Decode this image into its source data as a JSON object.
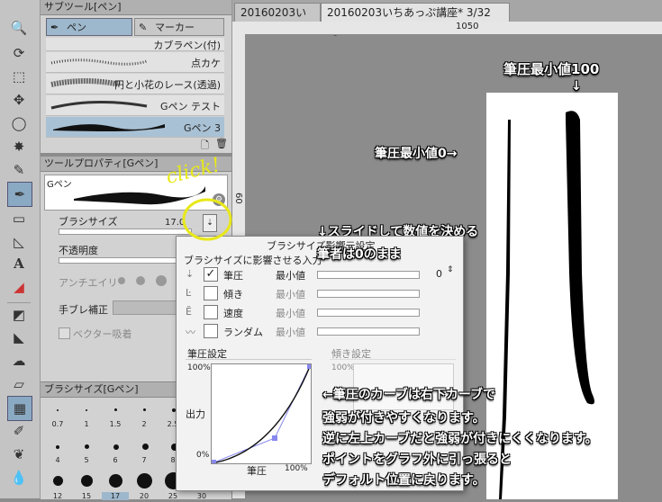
{
  "toolbar": {
    "tools": [
      "magnifier-icon",
      "rotate-icon",
      "object-icon",
      "move-icon",
      "lasso-icon",
      "wand-icon",
      "eyedropper-icon",
      "pen-icon",
      "brush-icon",
      "eraser-icon",
      "ruler-icon",
      "text-icon",
      "fill-icon"
    ]
  },
  "subtool": {
    "title": "サブツール[ペン]",
    "tab_pen": "ペン",
    "tab_marker": "マーカー",
    "brushes": [
      {
        "label": "カブラペン(付)"
      },
      {
        "label": "点カケ"
      },
      {
        "label": "円と小花のレース(透過)"
      },
      {
        "label": "Gペン テスト"
      },
      {
        "label": "Gペン 3"
      }
    ]
  },
  "toolprop": {
    "title": "ツールプロパティ[Gペン]",
    "preview_label": "Gペン",
    "brush_size_label": "ブラシサイズ",
    "brush_size_value": "17.0",
    "opacity_label": "不透明度",
    "antialias_label": "アンチエイリ",
    "stabilize_label": "手ブレ補正",
    "vector_label": "ベクター吸着"
  },
  "brushsize": {
    "title": "ブラシサイズ[Gペン]",
    "row1": [
      "0.7",
      "1",
      "1.5",
      "2",
      "2.5"
    ],
    "row2": [
      "4",
      "5",
      "6",
      "7",
      "8"
    ],
    "row3": [
      "12",
      "15",
      "17",
      "20",
      "25",
      "30"
    ]
  },
  "tabs": [
    {
      "label": "20160203い"
    },
    {
      "label": "20160203いちあっぷ講座* 3/32"
    }
  ],
  "ruler": {
    "mark": "1050"
  },
  "vruler": {
    "mark": "60"
  },
  "dialog": {
    "title": "ブラシサイズ影響元設定",
    "subtitle": "ブラシサイズに影響させる入力",
    "rows": [
      {
        "label": "筆圧",
        "min": "最小値",
        "checked": true,
        "value": "0"
      },
      {
        "label": "傾き",
        "min": "最小値",
        "checked": false
      },
      {
        "label": "速度",
        "min": "最小値",
        "checked": false
      },
      {
        "label": "ランダム",
        "min": "最小値",
        "checked": false
      }
    ],
    "curve_title": "筆圧設定",
    "tilt_title": "傾き設定",
    "y_top": "100%",
    "y_bottom": "0%",
    "y_label": "出力",
    "x_label": "筆圧",
    "x_right": "100%",
    "tilt_y_top": "100%"
  },
  "annotations": {
    "click": "click!",
    "min100": "筆圧最小値100",
    "min0": "筆圧最小値0→",
    "slide1": "↓スライドして数値を決める",
    "slide2": "筆者は0のまま",
    "curve1": "←筆圧のカーブは右下カーブで",
    "curve2": "強弱が付きやすくなります。",
    "curve3": "逆に左上カーブだと強弱が付きにくくなります。",
    "curve4": "ポイントをグラフ外に引っ張ると",
    "curve5": "デフォルト位置に戻ります。"
  },
  "colors": {
    "accent": "#8aa9c2",
    "highlight": "#e8e81a",
    "curve_point": "#8888ee"
  }
}
